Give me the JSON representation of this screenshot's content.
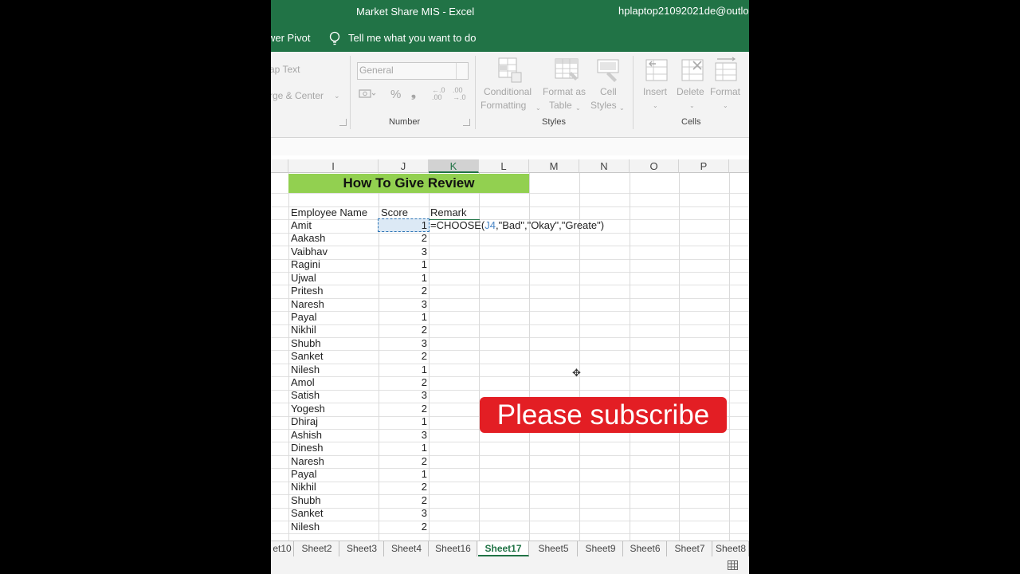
{
  "titlebar": {
    "title": "Market Share MIS  -  Excel",
    "account": "hplaptop21092021de@outlo"
  },
  "menubar": {
    "tab": "wer Pivot",
    "tellme": "Tell me what you want to do"
  },
  "ribbon": {
    "wrap_text": "ap Text",
    "merge_center": "rge & Center",
    "number_format": "General",
    "percent": "%",
    "comma": "❟",
    "inc_decimal": "←.0\n.00",
    "dec_decimal": ".00\n→.0",
    "number_label": "Number",
    "conditional_1": "Conditional",
    "conditional_2": "Formatting",
    "format_table_1": "Format as",
    "format_table_2": "Table",
    "cell_styles_1": "Cell",
    "cell_styles_2": "Styles",
    "styles_label": "Styles",
    "insert": "Insert",
    "delete": "Delete",
    "format": "Format",
    "cells_label": "Cells"
  },
  "columns": [
    "I",
    "J",
    "K",
    "L",
    "M",
    "N",
    "O",
    "P"
  ],
  "sheet": {
    "heading": "How To Give Review",
    "headers": {
      "name": "Employee Name",
      "score": "Score",
      "remark": "Remark"
    },
    "formula": {
      "fn": "=CHOOSE(",
      "ref": "J4",
      "rest": ",\"Bad\",\"Okay\",\"Greate\")"
    },
    "rows": [
      {
        "name": "Amit",
        "score": "1"
      },
      {
        "name": "Aakash",
        "score": "2"
      },
      {
        "name": "Vaibhav",
        "score": "3"
      },
      {
        "name": "Ragini",
        "score": "1"
      },
      {
        "name": "Ujwal",
        "score": "1"
      },
      {
        "name": "Pritesh",
        "score": "2"
      },
      {
        "name": "Naresh",
        "score": "3"
      },
      {
        "name": "Payal",
        "score": "1"
      },
      {
        "name": "Nikhil",
        "score": "2"
      },
      {
        "name": "Shubh",
        "score": "3"
      },
      {
        "name": "Sanket",
        "score": "2"
      },
      {
        "name": "Nilesh",
        "score": "1"
      },
      {
        "name": "Amol",
        "score": "2"
      },
      {
        "name": "Satish",
        "score": "3"
      },
      {
        "name": "Yogesh",
        "score": "2"
      },
      {
        "name": "Dhiraj",
        "score": "1"
      },
      {
        "name": "Ashish",
        "score": "3"
      },
      {
        "name": "Dinesh",
        "score": "1"
      },
      {
        "name": "Naresh",
        "score": "2"
      },
      {
        "name": "Payal",
        "score": "1"
      },
      {
        "name": "Nikhil",
        "score": "2"
      },
      {
        "name": "Shubh",
        "score": "2"
      },
      {
        "name": "Sanket",
        "score": "3"
      },
      {
        "name": "Nilesh",
        "score": "2"
      }
    ]
  },
  "overlay": {
    "subscribe": "Please subscribe"
  },
  "tabs": [
    "et10",
    "Sheet2",
    "Sheet3",
    "Sheet4",
    "Sheet16",
    "Sheet17",
    "Sheet5",
    "Sheet9",
    "Sheet6",
    "Sheet7",
    "Sheet8"
  ],
  "active_tab": "Sheet17",
  "colors": {
    "excel_green": "#217346",
    "banner_green": "#92d050",
    "subscribe_red": "#e31e24"
  }
}
